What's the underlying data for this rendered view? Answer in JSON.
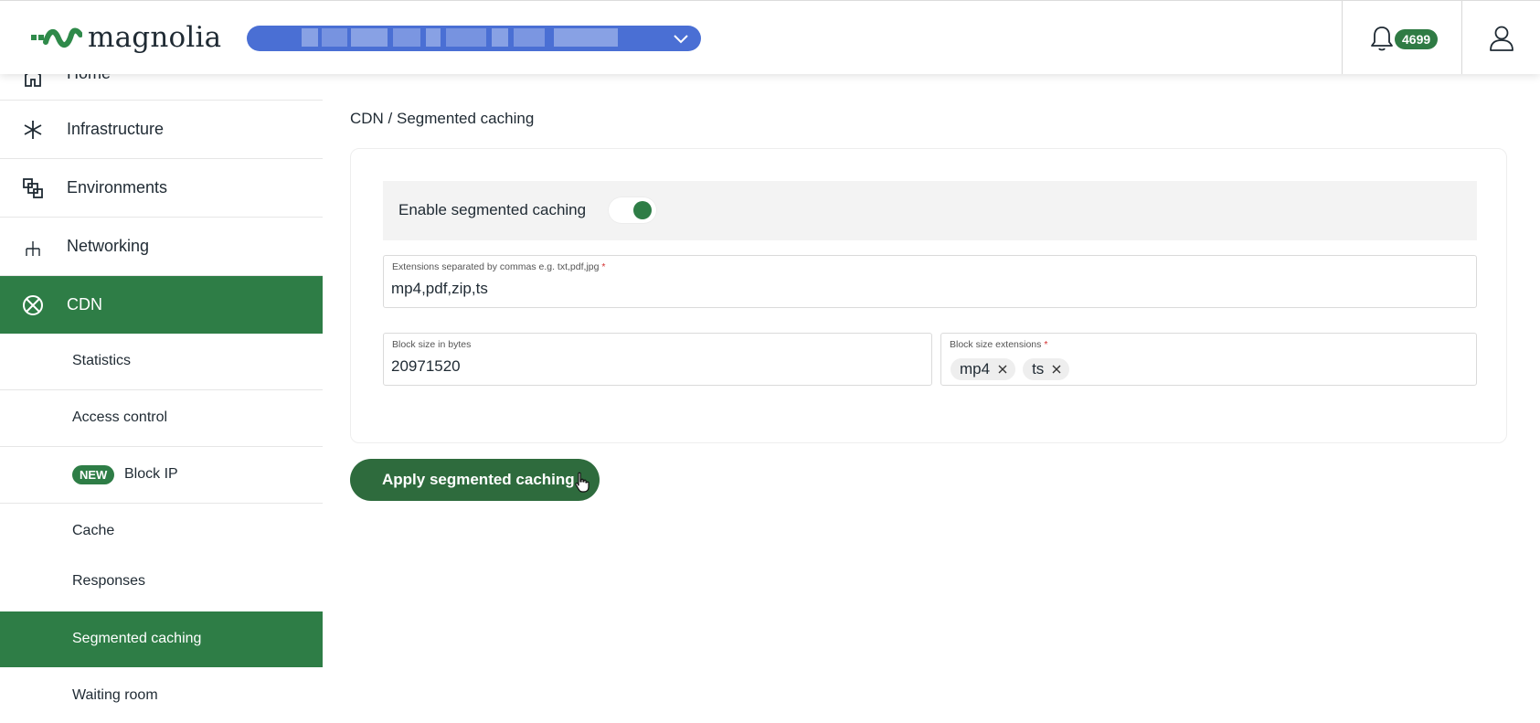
{
  "header": {
    "logo_text": "magnolia",
    "notifications_count": "4699"
  },
  "sidebar": {
    "partial_item": "Home",
    "items": [
      {
        "label": "Infrastructure",
        "icon": "asterisk-icon"
      },
      {
        "label": "Environments",
        "icon": "environments-icon"
      },
      {
        "label": "Networking",
        "icon": "network-icon"
      },
      {
        "label": "CDN",
        "icon": "cdn-icon",
        "active": true
      }
    ],
    "sub_items": [
      {
        "label": "Statistics"
      },
      {
        "label": "Access control"
      },
      {
        "label": "Block IP",
        "badge": "NEW"
      },
      {
        "label": "Cache"
      },
      {
        "label": "Responses"
      },
      {
        "label": "Segmented caching",
        "active": true
      },
      {
        "label": "Waiting room"
      }
    ]
  },
  "main": {
    "breadcrumb": "CDN / Segmented caching",
    "toggle": {
      "label": "Enable segmented caching",
      "enabled": true
    },
    "extensions_field": {
      "label": "Extensions separated by commas e.g. txt,pdf,jpg",
      "required_mark": "*",
      "value": "mp4,pdf,zip,ts"
    },
    "block_size_field": {
      "label": "Block size in bytes",
      "value": "20971520"
    },
    "block_ext_field": {
      "label": "Block size extensions",
      "required_mark": "*",
      "chips": [
        "mp4",
        "ts"
      ]
    },
    "apply_label": "Apply segmented caching"
  },
  "colors": {
    "brand_green": "#2e7d46",
    "button_green": "#2e6b3d",
    "site_select_blue": "#4a6fd4"
  }
}
